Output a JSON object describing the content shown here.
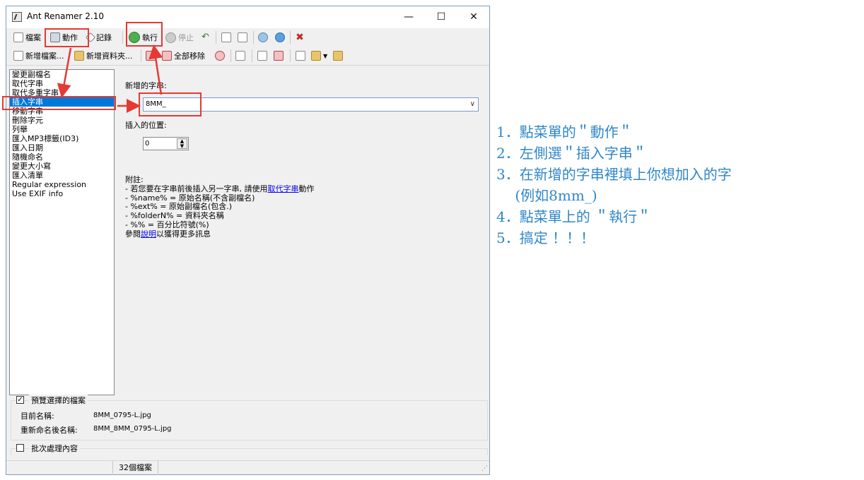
{
  "window": {
    "title": "Ant Renamer 2.10",
    "minimize": "—",
    "maximize": "☐",
    "close": "✕"
  },
  "toolbar1": {
    "file": "檔案",
    "actions": "動作",
    "log": "記錄",
    "go": "執行",
    "stop": "停止"
  },
  "toolbar2": {
    "add_files": "新增檔案...",
    "add_folder": "新增資料夾...",
    "remove_all": "全部移除"
  },
  "actions_list": [
    "變更副檔名",
    "取代字串",
    "取代多重字串",
    "插入字串",
    "移動字串",
    "刪除字元",
    "列舉",
    "匯入MP3標籤(ID3)",
    "匯入日期",
    "隨機命名",
    "變更大小寫",
    "匯入清單",
    "Regular expression",
    "Use EXIF info"
  ],
  "selected_action_index": 3,
  "insert": {
    "string_label": "新增的字串:",
    "string_value": "8MM_",
    "position_label": "插入的位置:",
    "position_value": "0"
  },
  "notes": {
    "title": "附註:",
    "line1_pre": "- 若您要在字串前後插入另一字串, 請使用",
    "line1_link": "取代字串",
    "line1_post": "動作",
    "line2": "- %name% = 原始名稱(不含副檔名)",
    "line3": "- %ext% = 原始副檔名(包含.)",
    "line4": "- %folderN% = 資料夾名稱",
    "line5": "- %% = 百分比符號(%)",
    "line6_pre": "參閱",
    "line6_link": "說明",
    "line6_post": "以獲得更多訊息"
  },
  "preview": {
    "checkbox_label": "預覽選擇的檔案",
    "checked": true,
    "current_label": "目前名稱:",
    "current_value": "8MM_0795-L.jpg",
    "renamed_label": "重新命名後名稱:",
    "renamed_value": "8MM_8MM_0795-L.jpg"
  },
  "batch": {
    "checkbox_label": "批次處理內容",
    "checked": false
  },
  "status": {
    "count": "32個檔案"
  },
  "instructions": [
    "1．點菜單的＂動作＂",
    "2．左側選＂插入字串＂",
    "3．在新增的字串裡填上你想加入的字",
    "　  (例如8mm_)",
    "4．點菜單上的 ＂執行＂",
    "5．搞定 ！！！"
  ],
  "colors": {
    "highlight": "#e53935",
    "selection": "#0078d7",
    "instruction_text": "#2f87c8"
  }
}
